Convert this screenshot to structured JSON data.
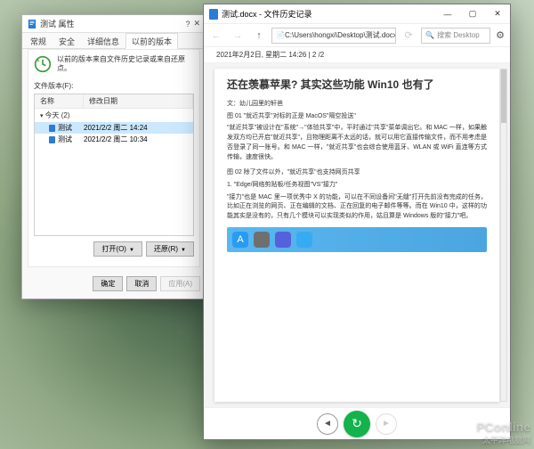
{
  "prop": {
    "title": "测试 属性",
    "tabs": {
      "general": "常规",
      "security": "安全",
      "details": "详细信息",
      "prev": "以前的版本"
    },
    "info": "以前的版本来自文件历史记录或来自还原点。",
    "list_label": "文件版本(F):",
    "cols": {
      "name": "名称",
      "date": "修改日期"
    },
    "group": "今天 (2)",
    "rows": [
      {
        "name": "测试",
        "date": "2021/2/2 周二 14:24"
      },
      {
        "name": "测试",
        "date": "2021/2/2 周二 10:34"
      }
    ],
    "open": "打开(O)",
    "restore": "还原(R)",
    "ok": "确定",
    "cancel": "取消",
    "apply": "应用(A)"
  },
  "fh": {
    "title": "测试.docx - 文件历史记录",
    "path": "C:\\Users\\hongxi\\Desktop\\测试.docx",
    "search_ph": "搜索 Desktop",
    "meta": "2021年2月2日, 星期二 14:26  |  2 /2",
    "doc": {
      "h": "还在羡慕苹果? 其实这些功能 Win10 也有了",
      "author": "文：幼儿园里的轩爸",
      "cap1": "图 01 \"就近共享\"对标的正是 MacOS\"隔空投送\"",
      "p1": "\"就近共享\"被设计在\"系统\"→\"体验共享\"中，平时通过\"共享\"菜单调出它。和 MAC 一样，如果触发双方均已开启\"就近共享\"，且物理距离不太远的话，就可以用它直接传输文件，而不用考虑是否登录了同一账号。和 MAC 一样，\"就近共享\"也会综合使用蓝牙、WLAN 或 WiFi 直连等方式传输，速度很快。",
      "cap2": "图 02 除了文件以外，\"就近共享\"也支持网页共享",
      "li": "1. \"Edge/网络剪贴板/任务视图\"VS\"接力\"",
      "p2": "\"接力\"也是 MAC 里一项优秀中 X 的功能，可以在不同设备间\"无缝\"打开先前没有完成的任务，比如正在浏览的网页、正在编辑的文档、正在回复的电子邮件等等。而在 Win10 中，这样的功能其实是没有的，只有几个模块可以实现类似的作用，姑且算是 Windows 版的\"接力\"吧。"
    }
  },
  "wm": {
    "main": "PConline",
    "sub": "太平洋电脑网"
  }
}
